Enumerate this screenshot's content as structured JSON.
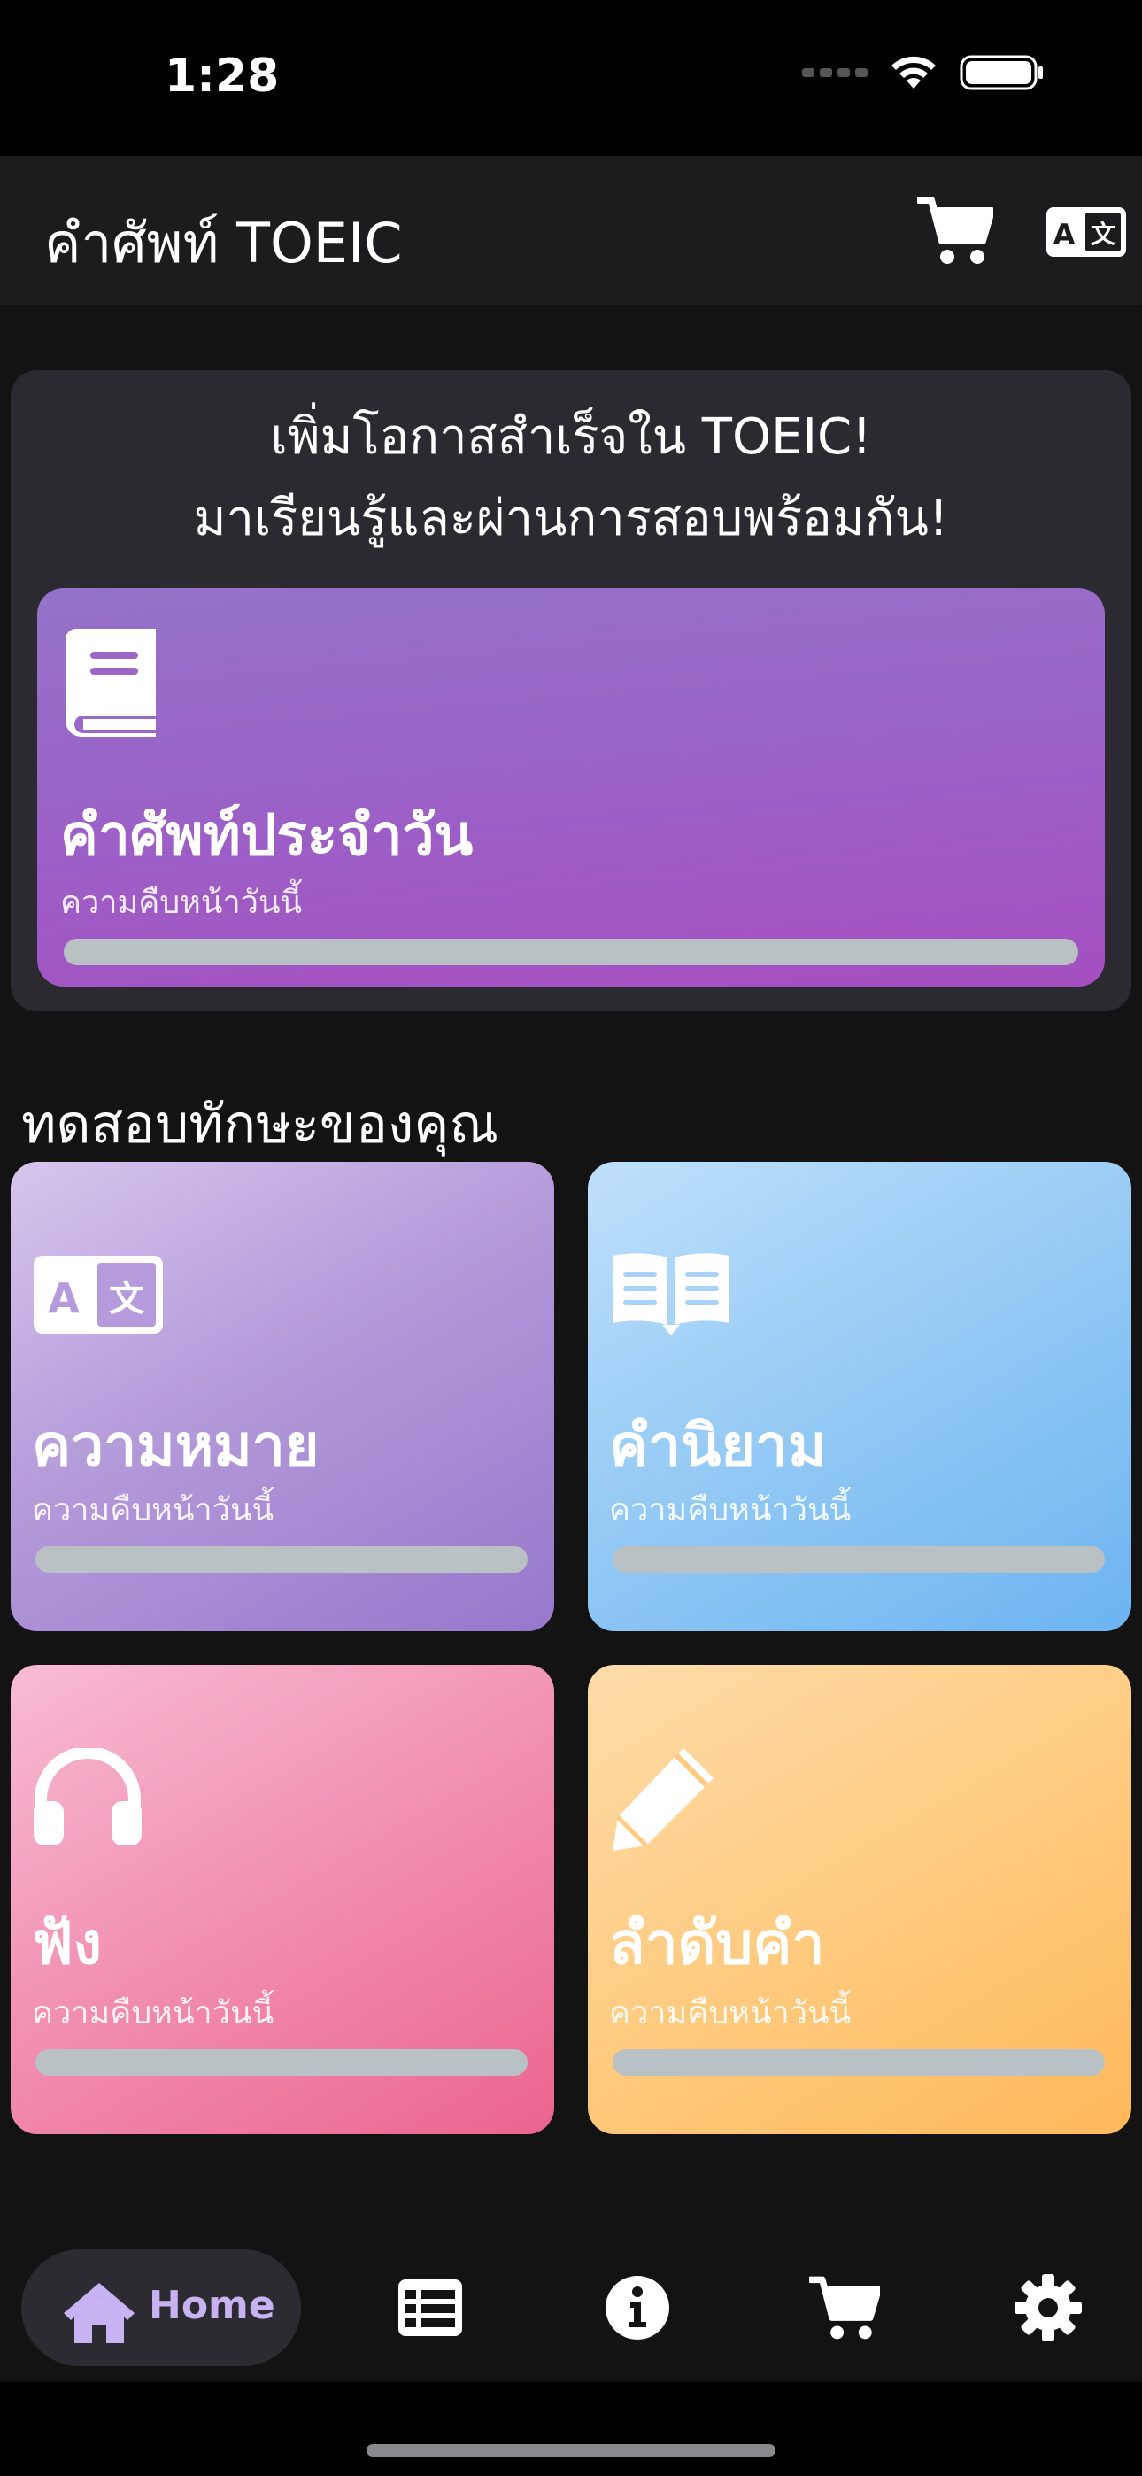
{
  "status_bar": {
    "time": "1:28"
  },
  "app_bar": {
    "title": "คำศัพท์ TOEIC",
    "cart_icon": "cart-icon",
    "translate_icon": "translate-icon"
  },
  "hero": {
    "line1": "เพิ่มโอกาสสำเร็จใน TOEIC!",
    "line2": "มาเรียนรู้และผ่านการสอบพร้อมกัน!",
    "daily_card": {
      "title": "คำศัพท์ประจำวัน",
      "subtitle": "ความคืบหน้าวันนี้",
      "progress": 0,
      "icon": "book-icon"
    }
  },
  "section": {
    "title": "ทดสอบทักษะของคุณ"
  },
  "skills": [
    {
      "title": "ความหมาย",
      "subtitle": "ความคืบหน้าวันนี้",
      "progress": 0,
      "icon": "translate-icon"
    },
    {
      "title": "คำนิยาม",
      "subtitle": "ความคืบหน้าวันนี้",
      "progress": 0,
      "icon": "open-book-icon"
    },
    {
      "title": "ฟัง",
      "subtitle": "ความคืบหน้าวันนี้",
      "progress": 0,
      "icon": "headphones-icon"
    },
    {
      "title": "ลำดับคำ",
      "subtitle": "ความคืบหน้าวันนี้",
      "progress": 0,
      "icon": "pencil-icon"
    }
  ],
  "bottom_nav": {
    "home_label": "Home",
    "items": [
      "home-icon",
      "list-icon",
      "info-icon",
      "cart-icon",
      "settings-icon"
    ],
    "active_color": "#c7b3f2"
  }
}
